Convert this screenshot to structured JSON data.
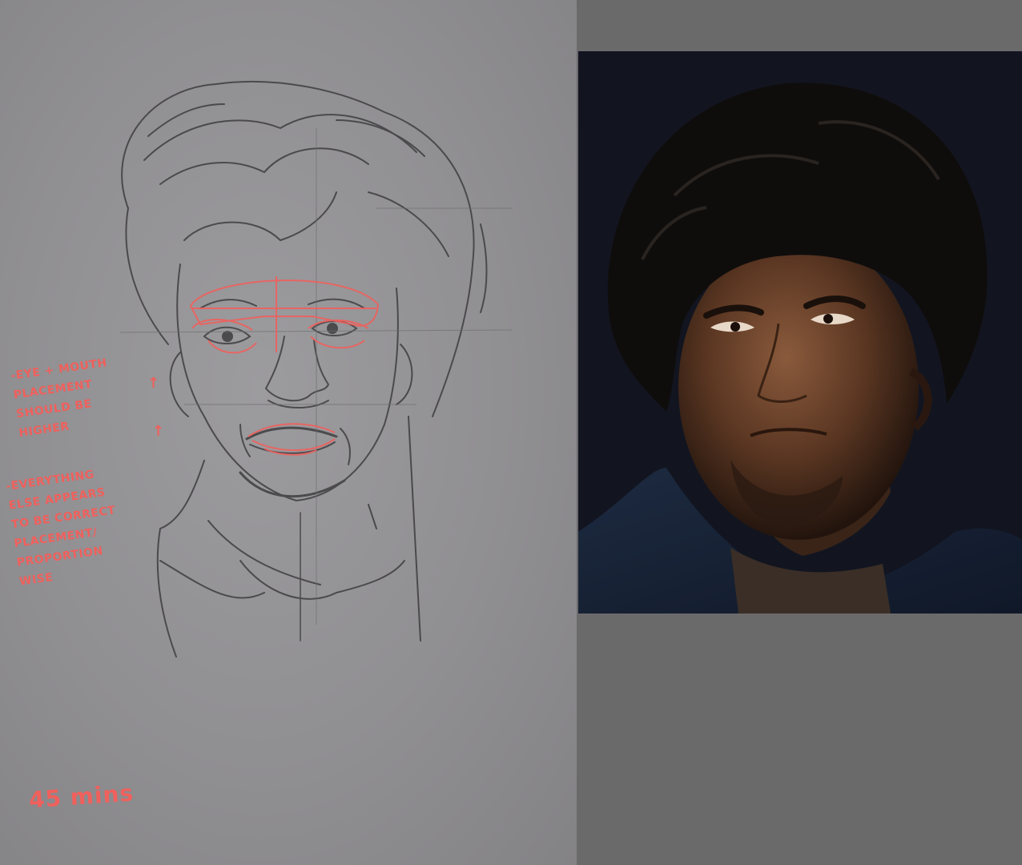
{
  "annotations": {
    "note_1": "-EYE + MOUTH\nPLACEMENT\nSHOULD BE\nHIGHER",
    "arrow_1": "↑",
    "arrow_2": "↑",
    "note_2": "-EVERYTHING\nELSE APPEARS\nTO BE CORRECT\nPLACEMENT/\nPROPORTION\nWISE",
    "time": "45 mins"
  },
  "colors": {
    "paper": "#939295",
    "background": "#6b6a6b",
    "annotation": "#f0605c",
    "photo_backdrop": "#121520"
  }
}
